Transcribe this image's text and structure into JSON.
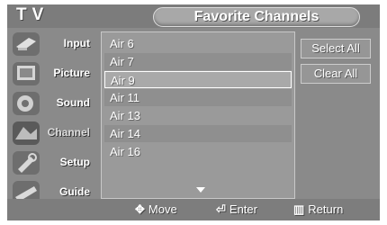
{
  "header": {
    "tv_label": "TV",
    "title": "Favorite Channels"
  },
  "sidebar": {
    "items": [
      {
        "label": "Input",
        "icon": "input-icon"
      },
      {
        "label": "Picture",
        "icon": "picture-icon"
      },
      {
        "label": "Sound",
        "icon": "sound-icon"
      },
      {
        "label": "Channel",
        "icon": "channel-icon"
      },
      {
        "label": "Setup",
        "icon": "setup-icon"
      },
      {
        "label": "Guide",
        "icon": "guide-icon"
      }
    ]
  },
  "channel_list": {
    "items": [
      "Air 6",
      "Air 7",
      "Air 9",
      "Air 11",
      "Air 13",
      "Air 14",
      "Air 16"
    ],
    "highlighted": "Air 9"
  },
  "actions": {
    "select_all": "Select All",
    "clear_all": "Clear All"
  },
  "footer": {
    "move": "Move",
    "enter": "Enter",
    "return": "Return"
  }
}
